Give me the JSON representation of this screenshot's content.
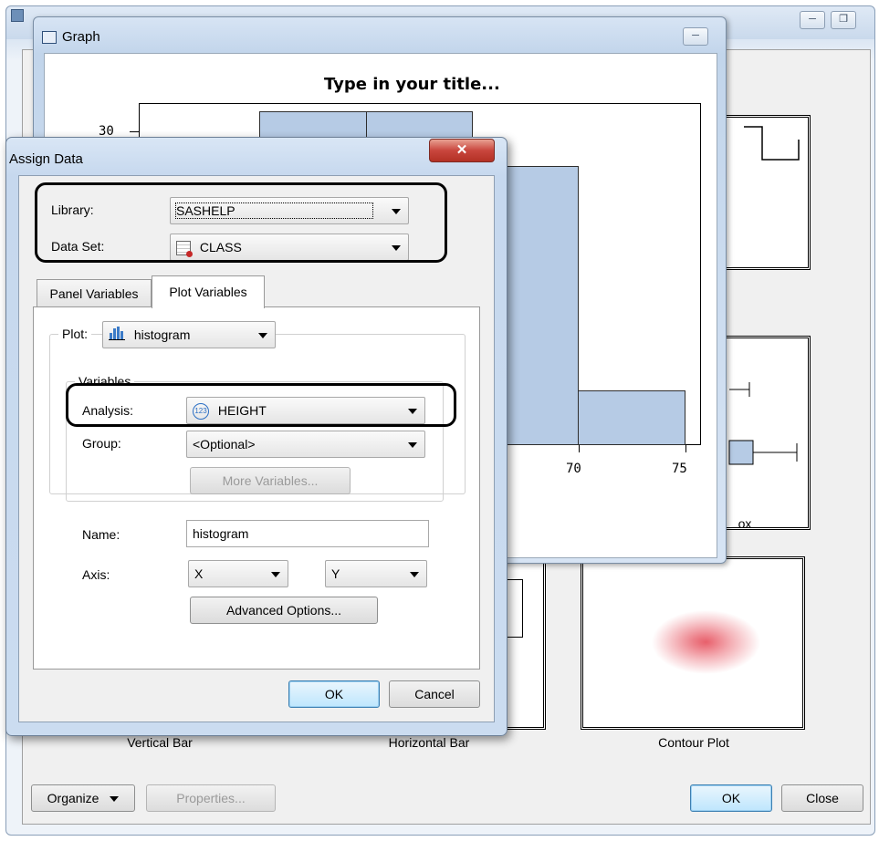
{
  "graph_window": {
    "title": "Graph",
    "chart_title": "Type in your title...",
    "y_tick": "30",
    "x_ticks": [
      "70",
      "75"
    ]
  },
  "gallery": {
    "thumbnails": [
      {
        "caption": "Vertical Bar"
      },
      {
        "caption": "Horizontal Bar"
      },
      {
        "caption": "Contour Plot"
      },
      {
        "caption": "ox"
      }
    ],
    "buttons": {
      "organize": "Organize",
      "properties": "Properties...",
      "ok": "OK",
      "close": "Close"
    }
  },
  "dialog": {
    "title": "Assign Data",
    "library_label": "Library:",
    "library_value": "SASHELP",
    "dataset_label": "Data Set:",
    "dataset_value": "CLASS",
    "tabs": [
      "Panel Variables",
      "Plot Variables"
    ],
    "active_tab": "Plot Variables",
    "plot_label": "Plot:",
    "plot_value": "histogram",
    "variables_label": "Variables",
    "analysis_label": "Analysis:",
    "analysis_value": "HEIGHT",
    "group_label": "Group:",
    "group_value": "<Optional>",
    "more_variables": "More Variables...",
    "name_label": "Name:",
    "name_value": "histogram",
    "axis_label": "Axis:",
    "axis_x": "X",
    "axis_y": "Y",
    "advanced_options": "Advanced Options...",
    "ok": "OK",
    "cancel": "Cancel"
  },
  "colors": {
    "bar_fill": "#b6cbe5",
    "title_bar": "#c9d9ec",
    "close_button": "#c9463d"
  }
}
